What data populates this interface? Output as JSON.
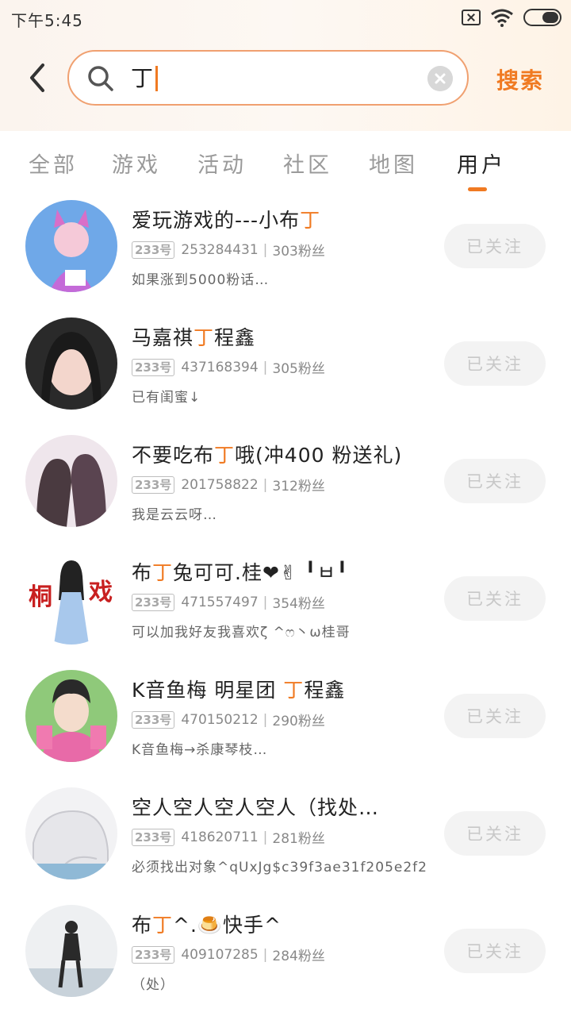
{
  "status_bar": {
    "time": "下午5:45"
  },
  "search": {
    "query": "丁",
    "button_label": "搜索"
  },
  "tabs": [
    {
      "label": "全部",
      "active": false
    },
    {
      "label": "游戏",
      "active": false
    },
    {
      "label": "活动",
      "active": false
    },
    {
      "label": "社区",
      "active": false
    },
    {
      "label": "地图",
      "active": false
    },
    {
      "label": "用户",
      "active": true
    }
  ],
  "colors": {
    "accent": "#f07a22",
    "search_border": "#f0a070"
  },
  "users": [
    {
      "name_before": "爱玩游戏的---小布",
      "name_hl": "丁",
      "name_after": "",
      "badge": "233号",
      "id": "253284431",
      "fans": "303粉丝",
      "bio": "如果涨到5000粉话…",
      "follow_label": "已关注"
    },
    {
      "name_before": "马嘉祺",
      "name_hl": "丁",
      "name_after": "程鑫",
      "badge": "233号",
      "id": "437168394",
      "fans": "305粉丝",
      "bio": "已有闺蜜↓",
      "follow_label": "已关注"
    },
    {
      "name_before": "不要吃布",
      "name_hl": "丁",
      "name_after": "哦(冲400 粉送礼)",
      "badge": "233号",
      "id": "201758822",
      "fans": "312粉丝",
      "bio": "我是云云呀…",
      "follow_label": "已关注"
    },
    {
      "name_before": "布",
      "name_hl": "丁",
      "name_after": "兔可可.桂❤✌ ╹ㅂ╹",
      "badge": "233号",
      "id": "471557497",
      "fans": "354粉丝",
      "bio": "可以加我好友我喜欢ζ ^ෆ丶ω桂哥",
      "follow_label": "已关注"
    },
    {
      "name_before": "K音鱼梅 明星团 ",
      "name_hl": "丁",
      "name_after": "程鑫",
      "badge": "233号",
      "id": "470150212",
      "fans": "290粉丝",
      "bio": "K音鱼梅→杀康琴枝…",
      "follow_label": "已关注"
    },
    {
      "name_before": "空人空人空人空人（找处…",
      "name_hl": "",
      "name_after": "",
      "badge": "233号",
      "id": "418620711",
      "fans": "281粉丝",
      "bio": "必须找出对象^qUxJg$c39f3ae31f205e2f2",
      "follow_label": "已关注"
    },
    {
      "name_before": "布",
      "name_hl": "丁",
      "name_after": "^.🍮快手^",
      "badge": "233号",
      "id": "409107285",
      "fans": "284粉丝",
      "bio": "（处）",
      "follow_label": "已关注"
    }
  ]
}
